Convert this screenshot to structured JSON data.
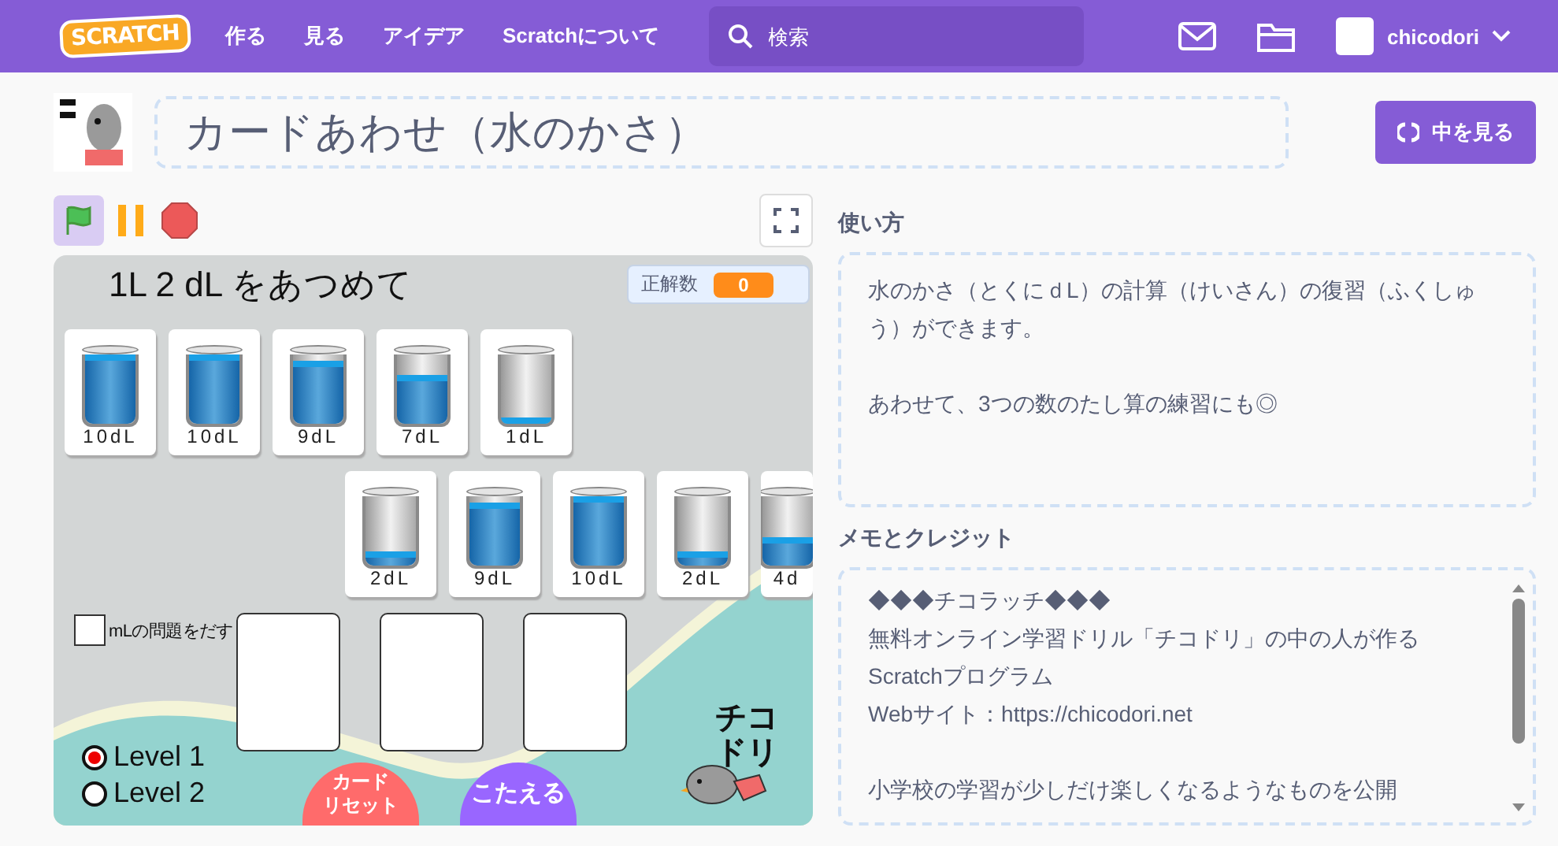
{
  "nav": {
    "logo": "SCRATCH",
    "items": [
      "作る",
      "見る",
      "アイデア",
      "Scratchについて"
    ],
    "search": {
      "placeholder": "検索"
    },
    "username": "chicodori"
  },
  "project": {
    "title": "カードあわせ（水のかさ）",
    "see_inside": "中を見る"
  },
  "controls": {
    "flag_active": true
  },
  "stage": {
    "prompt": "1L 2 dL をあつめて",
    "score_label": "正解数",
    "score": "0",
    "cards_top": [
      {
        "label": "10dL",
        "level": 1
      },
      {
        "label": "10dL",
        "level": 1
      },
      {
        "label": "9dL",
        "level": 0.9
      },
      {
        "label": "7dL",
        "level": 0.7
      },
      {
        "label": "1dL",
        "level": 0.1
      }
    ],
    "cards_bottom": [
      {
        "label": "2dL",
        "level": 0.2
      },
      {
        "label": "9dL",
        "level": 0.9
      },
      {
        "label": "10dL",
        "level": 1
      },
      {
        "label": "2dL",
        "level": 0.2
      },
      {
        "label": "4d",
        "level": 0.4
      }
    ],
    "ml_option": {
      "label": "mLの問題をだす",
      "checked": false
    },
    "answer_slots": [
      {
        "filled": false
      },
      {
        "filled": false
      },
      {
        "filled": false
      }
    ],
    "levels": [
      {
        "label": "Level 1",
        "selected": true
      },
      {
        "label": "Level 2",
        "selected": false
      }
    ],
    "reset_button": [
      "カード",
      "リセット"
    ],
    "answer_button": "こたえる",
    "logo": "チコドリ"
  },
  "instructions": {
    "heading": "使い方",
    "paragraphs": [
      "水のかさ（とくにｄL）の計算（けいさん）の復習（ふくしゅう）ができます。",
      "あわせて、3つの数のたし算の練習にも◎"
    ]
  },
  "credits": {
    "heading": "メモとクレジット",
    "paragraphs": [
      [
        "◆◆◆チコラッチ◆◆◆",
        "無料オンライン学習ドリル「チコドリ」の中の人が作るScratchプログラム",
        "Webサイト：https://chicodori.net"
      ],
      [
        "小学校の学習が少しだけ楽しくなるようなものを公開"
      ]
    ]
  }
}
